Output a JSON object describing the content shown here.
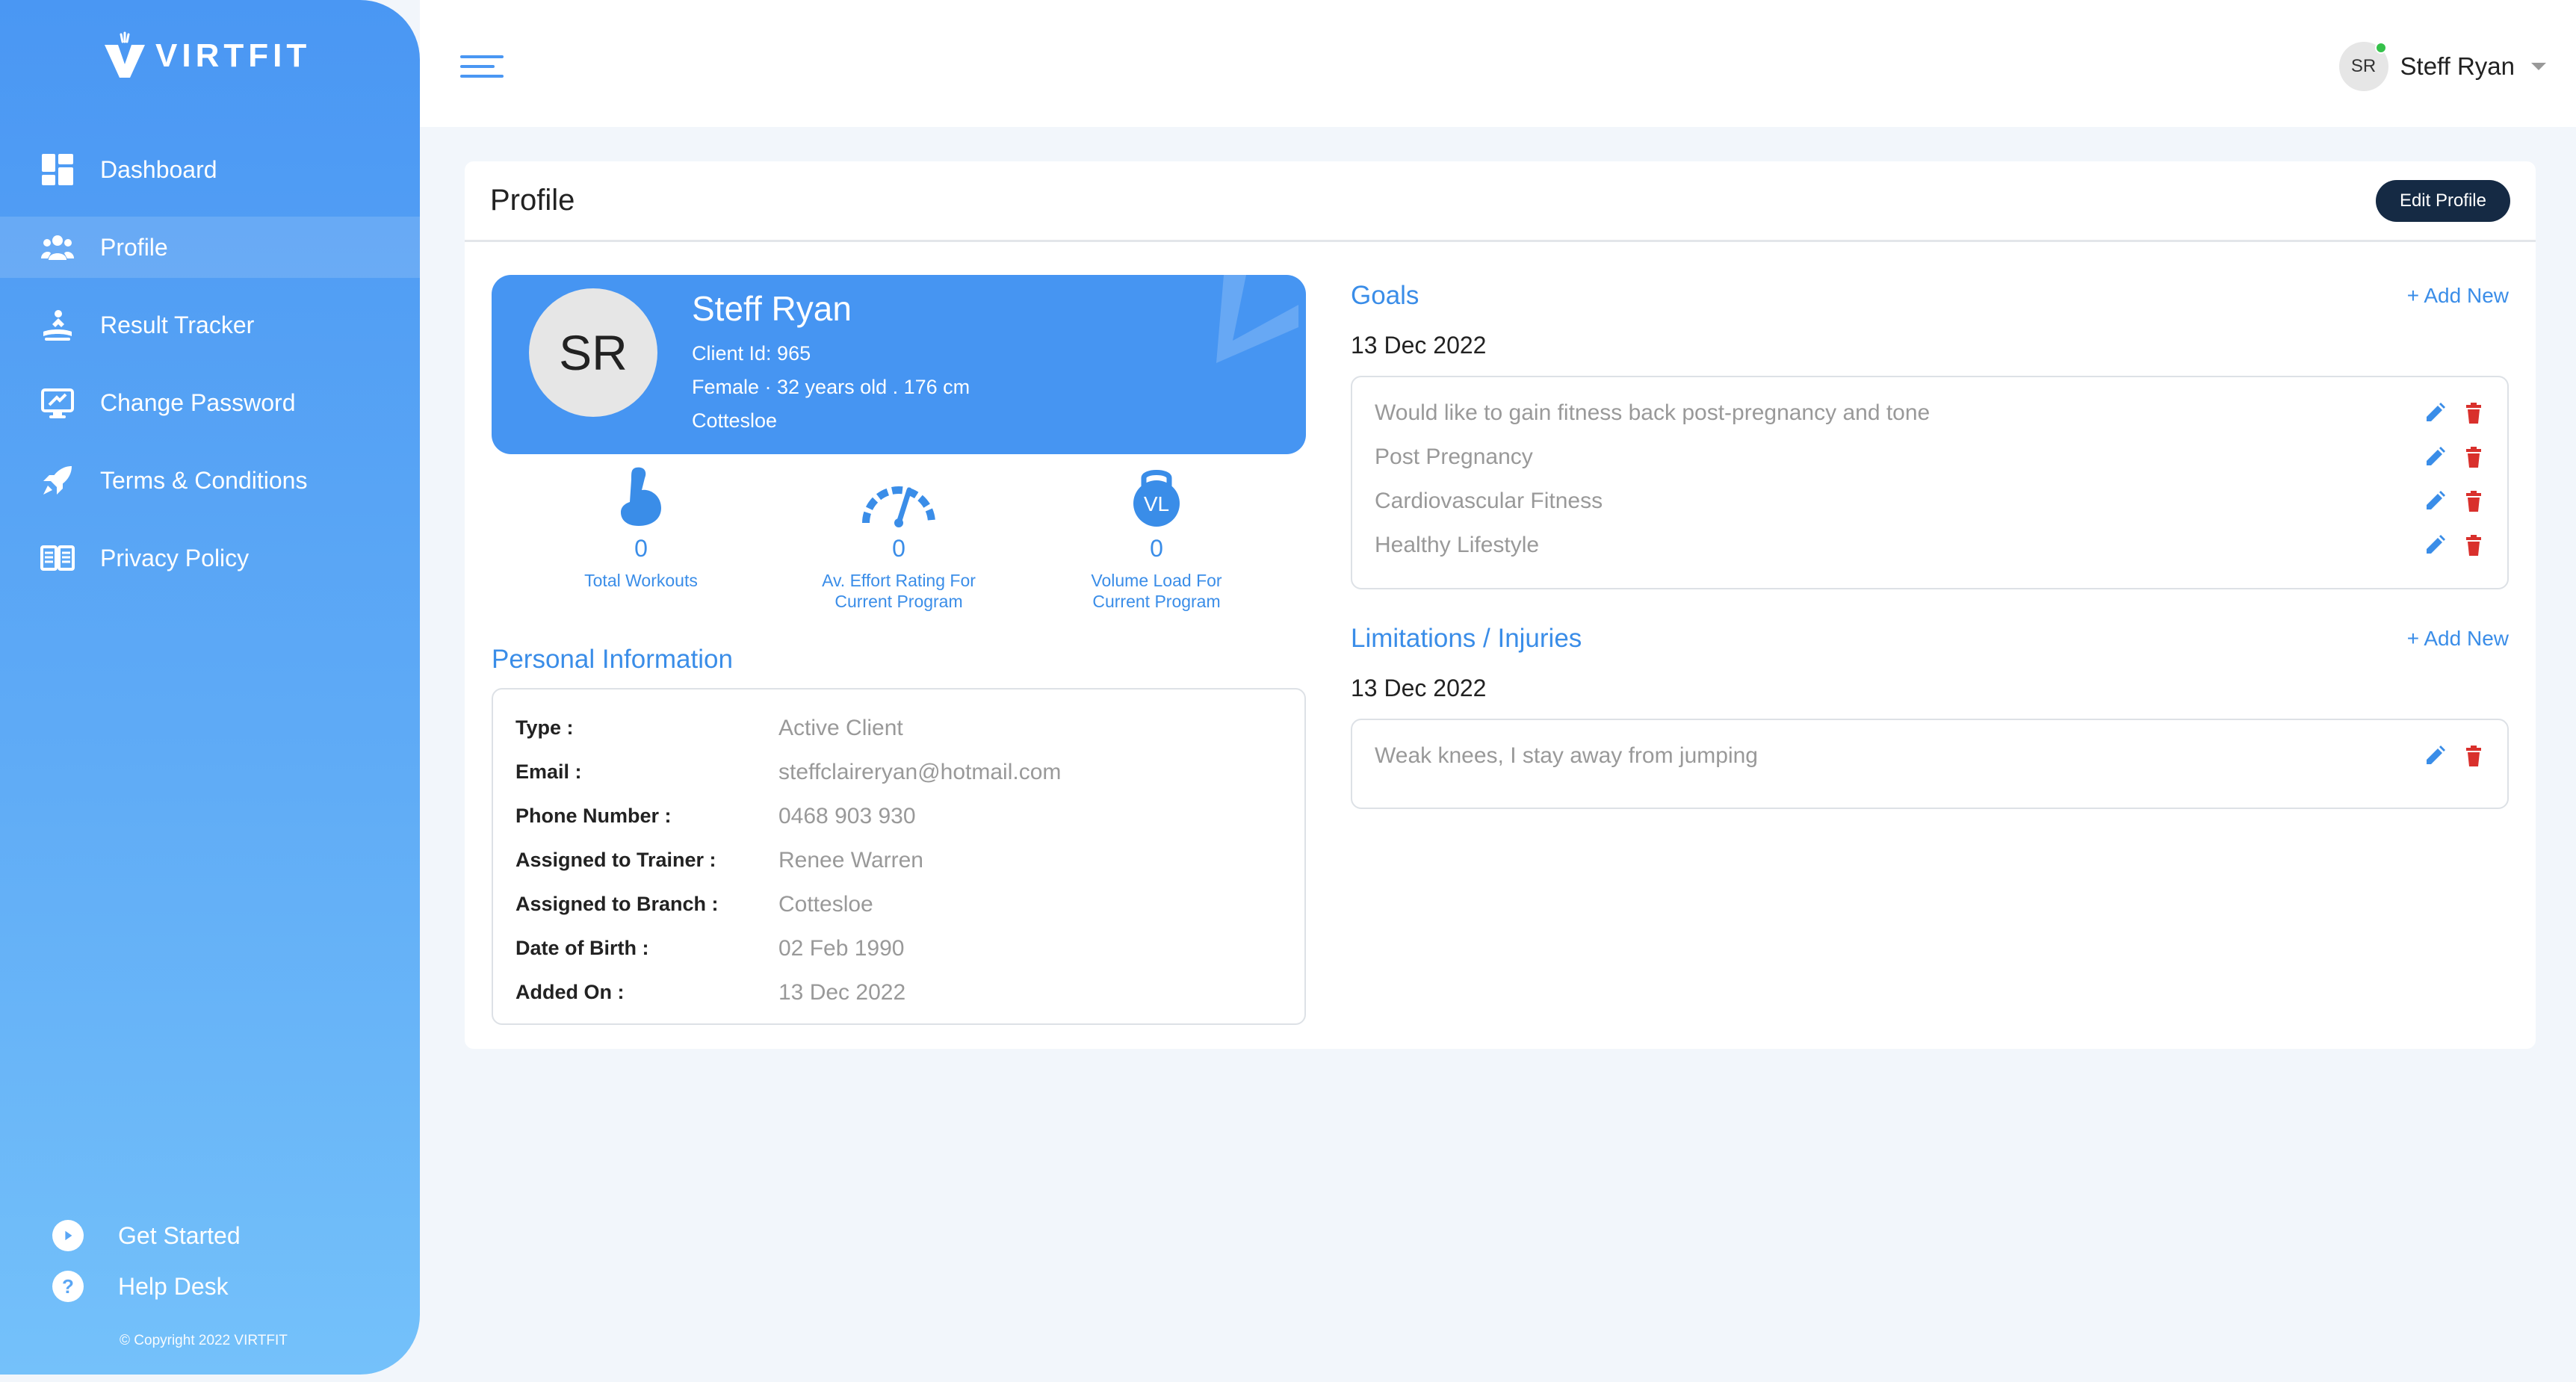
{
  "brand": {
    "name": "VIRTFIT",
    "copyright": "© Copyright 2022 VIRTFIT"
  },
  "colors": {
    "accent": "#4a97f3",
    "dark_button": "#152a44",
    "delete": "#d9302c",
    "online": "#35c14a"
  },
  "sidebar": {
    "items": [
      {
        "label": "Dashboard",
        "icon": "dashboard-icon",
        "active": false
      },
      {
        "label": "Profile",
        "icon": "users-icon",
        "active": true
      },
      {
        "label": "Result Tracker",
        "icon": "result-tracker-icon",
        "active": false
      },
      {
        "label": "Change Password",
        "icon": "monitor-lock-icon",
        "active": false
      },
      {
        "label": "Terms & Conditions",
        "icon": "rocket-icon",
        "active": false
      },
      {
        "label": "Privacy Policy",
        "icon": "book-icon",
        "active": false
      }
    ],
    "bottom": [
      {
        "label": "Get Started",
        "icon": "play-icon"
      },
      {
        "label": "Help Desk",
        "icon": "help-icon"
      }
    ]
  },
  "header": {
    "user_initials": "SR",
    "user_name": "Steff Ryan"
  },
  "profile": {
    "title": "Profile",
    "edit_label": "Edit Profile",
    "initials": "SR",
    "name": "Steff Ryan",
    "client_id": "Client Id: 965",
    "details": "Female · 32 years old . 176 cm",
    "location": "Cottesloe",
    "stats": [
      {
        "value": "0",
        "label_1": "Total Workouts",
        "label_2": "",
        "icon": "bicep-icon"
      },
      {
        "value": "0",
        "label_1": "Av. Effort Rating For",
        "label_2": "Current Program",
        "icon": "gauge-icon"
      },
      {
        "value": "0",
        "label_1": "Volume Load For",
        "label_2": "Current Program",
        "icon": "kettlebell-icon",
        "icon_text": "VL"
      }
    ]
  },
  "personal_info": {
    "title": "Personal Information",
    "rows": [
      {
        "label": "Type :",
        "value": "Active Client"
      },
      {
        "label": "Email :",
        "value": "steffclaireryan@hotmail.com"
      },
      {
        "label": "Phone Number :",
        "value": "0468 903 930"
      },
      {
        "label": "Assigned to Trainer :",
        "value": "Renee Warren"
      },
      {
        "label": "Assigned to Branch :",
        "value": "Cottesloe"
      },
      {
        "label": "Date of Birth :",
        "value": "02 Feb 1990"
      },
      {
        "label": "Added On :",
        "value": "13 Dec 2022"
      }
    ]
  },
  "goals": {
    "title": "Goals",
    "add_label": "+ Add New",
    "date": "13 Dec 2022",
    "items": [
      "Would like to gain fitness back post-pregnancy and tone",
      "Post Pregnancy",
      "Cardiovascular Fitness",
      "Healthy Lifestyle"
    ]
  },
  "limitations": {
    "title": "Limitations / Injuries",
    "add_label": "+ Add New",
    "date": "13 Dec 2022",
    "items": [
      "Weak knees, I stay away from jumping"
    ]
  }
}
